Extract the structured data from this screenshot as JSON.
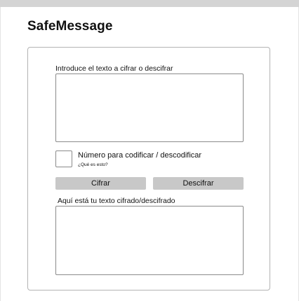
{
  "app": {
    "title": "SafeMessage"
  },
  "input_section": {
    "label": "Introduce el texto a cifrar o descifrar",
    "value": ""
  },
  "number_section": {
    "label": "Número para codificar / descodificar",
    "help_link": "¿Qué es esto?",
    "value": ""
  },
  "buttons": {
    "encrypt": "Cifrar",
    "decrypt": "Descifrar"
  },
  "output_section": {
    "label": "Aquí está tu texto cifrado/descifrado",
    "value": ""
  },
  "colors": {
    "top_bar": "#d4d4d4",
    "button_bg": "#c8c8c8",
    "border": "#8a8a8a"
  }
}
